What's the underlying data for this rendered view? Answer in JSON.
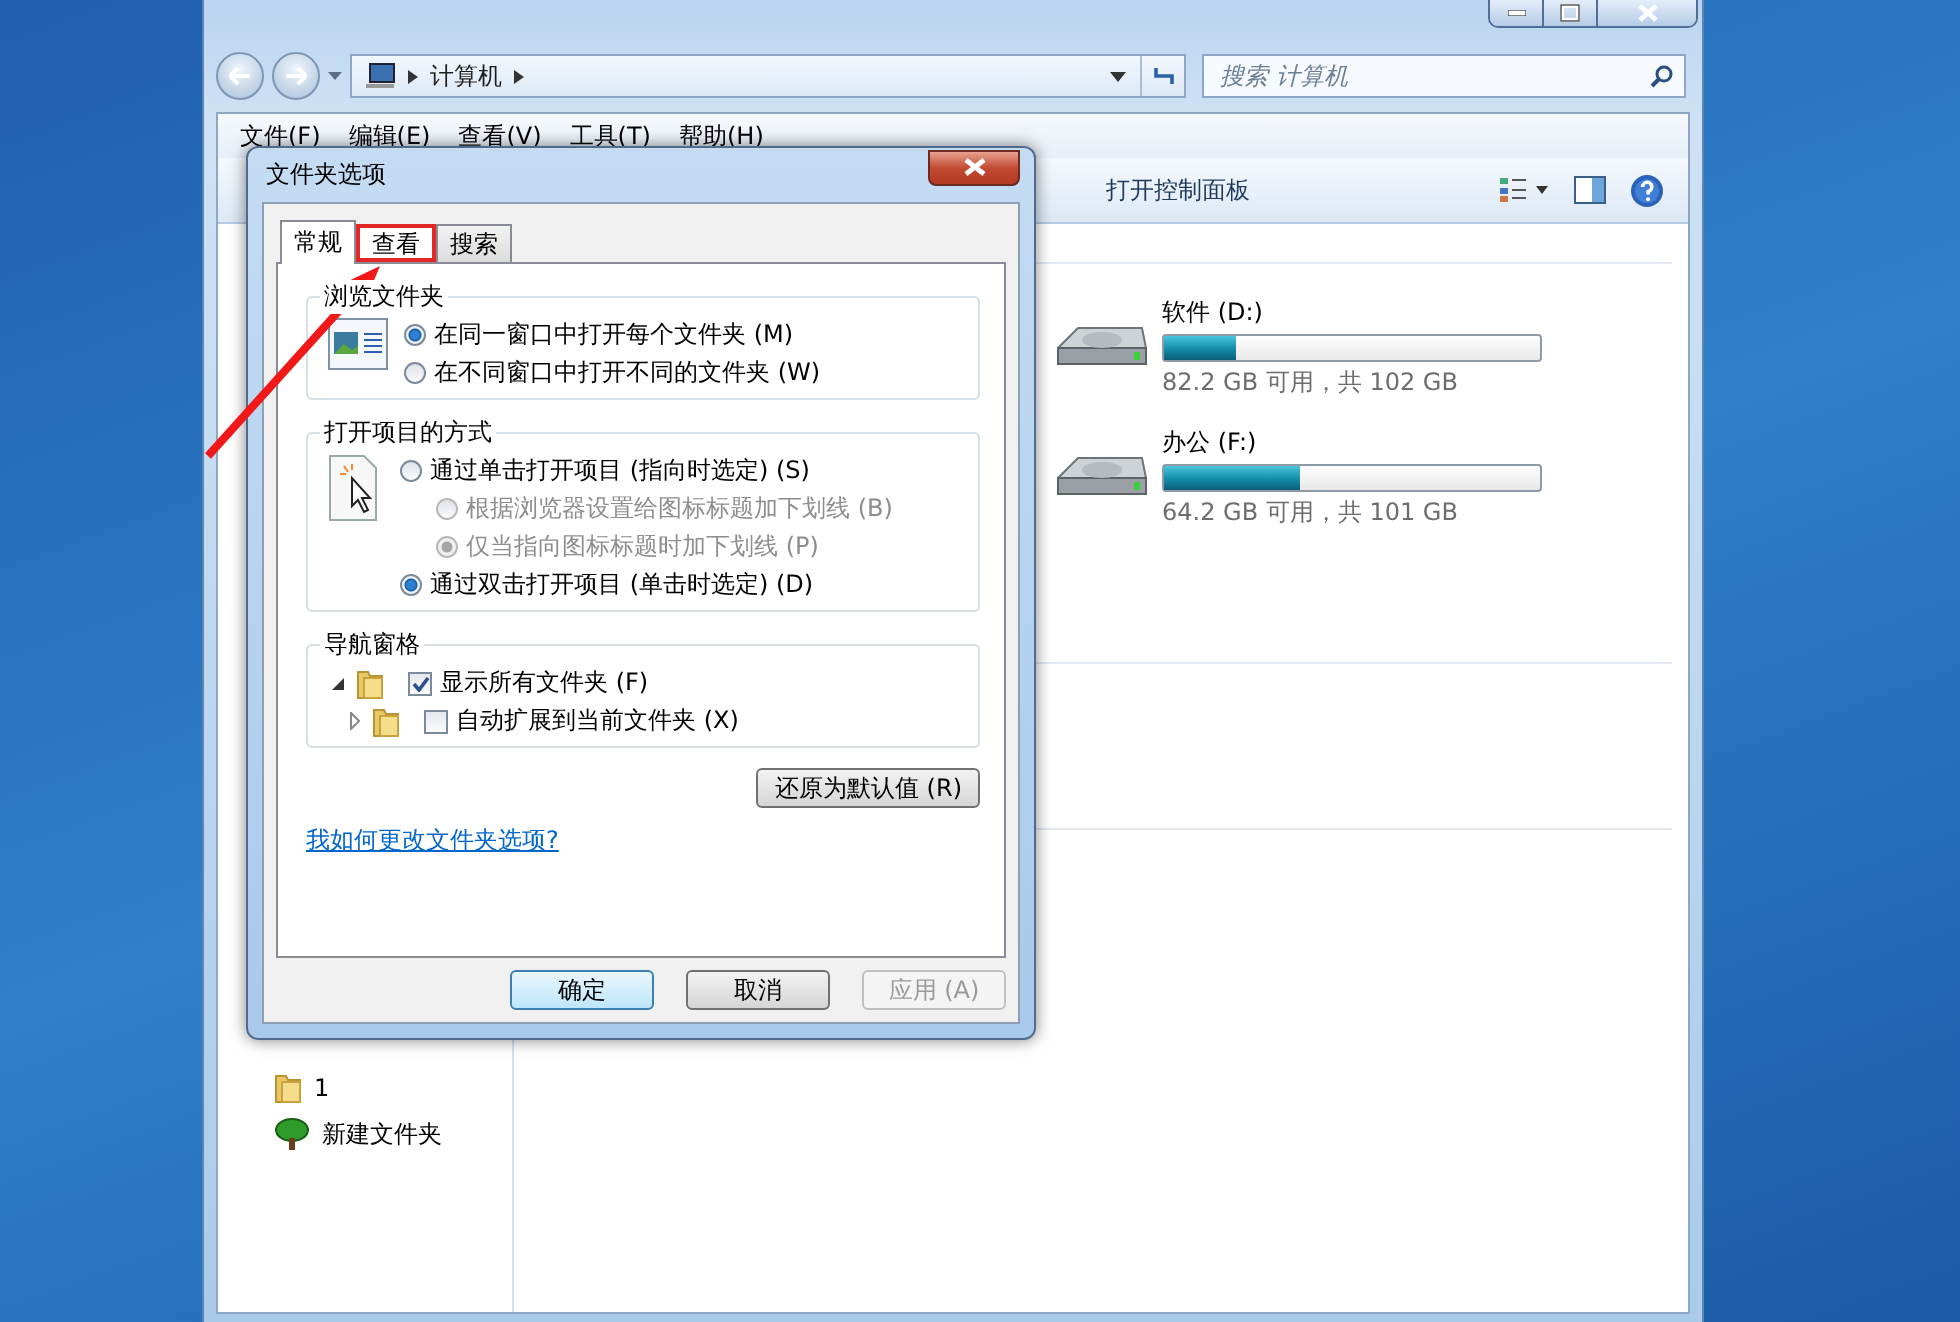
{
  "explorer": {
    "address": {
      "crumbs": [
        "计算机"
      ]
    },
    "search": {
      "placeholder": "搜索 计算机"
    },
    "menu": [
      "文件(F)",
      "编辑(E)",
      "查看(V)",
      "工具(T)",
      "帮助(H)"
    ],
    "toolbar": [
      {
        "label": "打开控制面板"
      }
    ],
    "nav_items": [
      {
        "label": "1",
        "kind": "folder"
      },
      {
        "label": "新建文件夹",
        "kind": "tree"
      }
    ],
    "drives": [
      {
        "name": "软件 (D:)",
        "level": 0.19,
        "reading": "82.2 GB 可用，共 102 GB"
      },
      {
        "name": "办公 (F:)",
        "level": 0.36,
        "reading": "64.2 GB 可用，共 101 GB"
      }
    ]
  },
  "dialog": {
    "title": "文件夹选项",
    "tabs": [
      {
        "label": "常规",
        "selected": true
      },
      {
        "label": "查看",
        "selected": false,
        "highlighted": true
      },
      {
        "label": "搜索",
        "selected": false,
        "highlighted": false
      }
    ],
    "browse": {
      "title": "浏览文件夹",
      "options": [
        {
          "label": "在同一窗口中打开每个文件夹 (M)",
          "selected": true
        },
        {
          "label": "在不同窗口中打开不同的文件夹 (W)",
          "selected": false
        }
      ]
    },
    "click": {
      "title": "打开项目的方式",
      "options": [
        {
          "label": "通过单击打开项目 (指向时选定) (S)",
          "selected": false,
          "children": [
            {
              "label": "根据浏览器设置给图标标题加下划线 (B)",
              "selected": false,
              "disabled": true
            },
            {
              "label": "仅当指向图标标题时加下划线 (P)",
              "selected": true,
              "disabled": true
            }
          ]
        },
        {
          "label": "通过双击打开项目 (单击时选定) (D)",
          "selected": true
        }
      ]
    },
    "nav": {
      "title": "导航窗格",
      "options": [
        {
          "label": "显示所有文件夹 (F)",
          "checked": true,
          "expanded": true
        },
        {
          "label": "自动扩展到当前文件夹 (X)",
          "checked": false,
          "expanded": false
        }
      ]
    },
    "restore": "还原为默认值 (R)",
    "link": "我如何更改文件夹选项?",
    "buttons": [
      {
        "label": "确定",
        "kind": "default",
        "disabled": false
      },
      {
        "label": "取消",
        "kind": "normal",
        "disabled": false
      },
      {
        "label": "应用 (A)",
        "kind": "normal",
        "disabled": true
      }
    ]
  }
}
